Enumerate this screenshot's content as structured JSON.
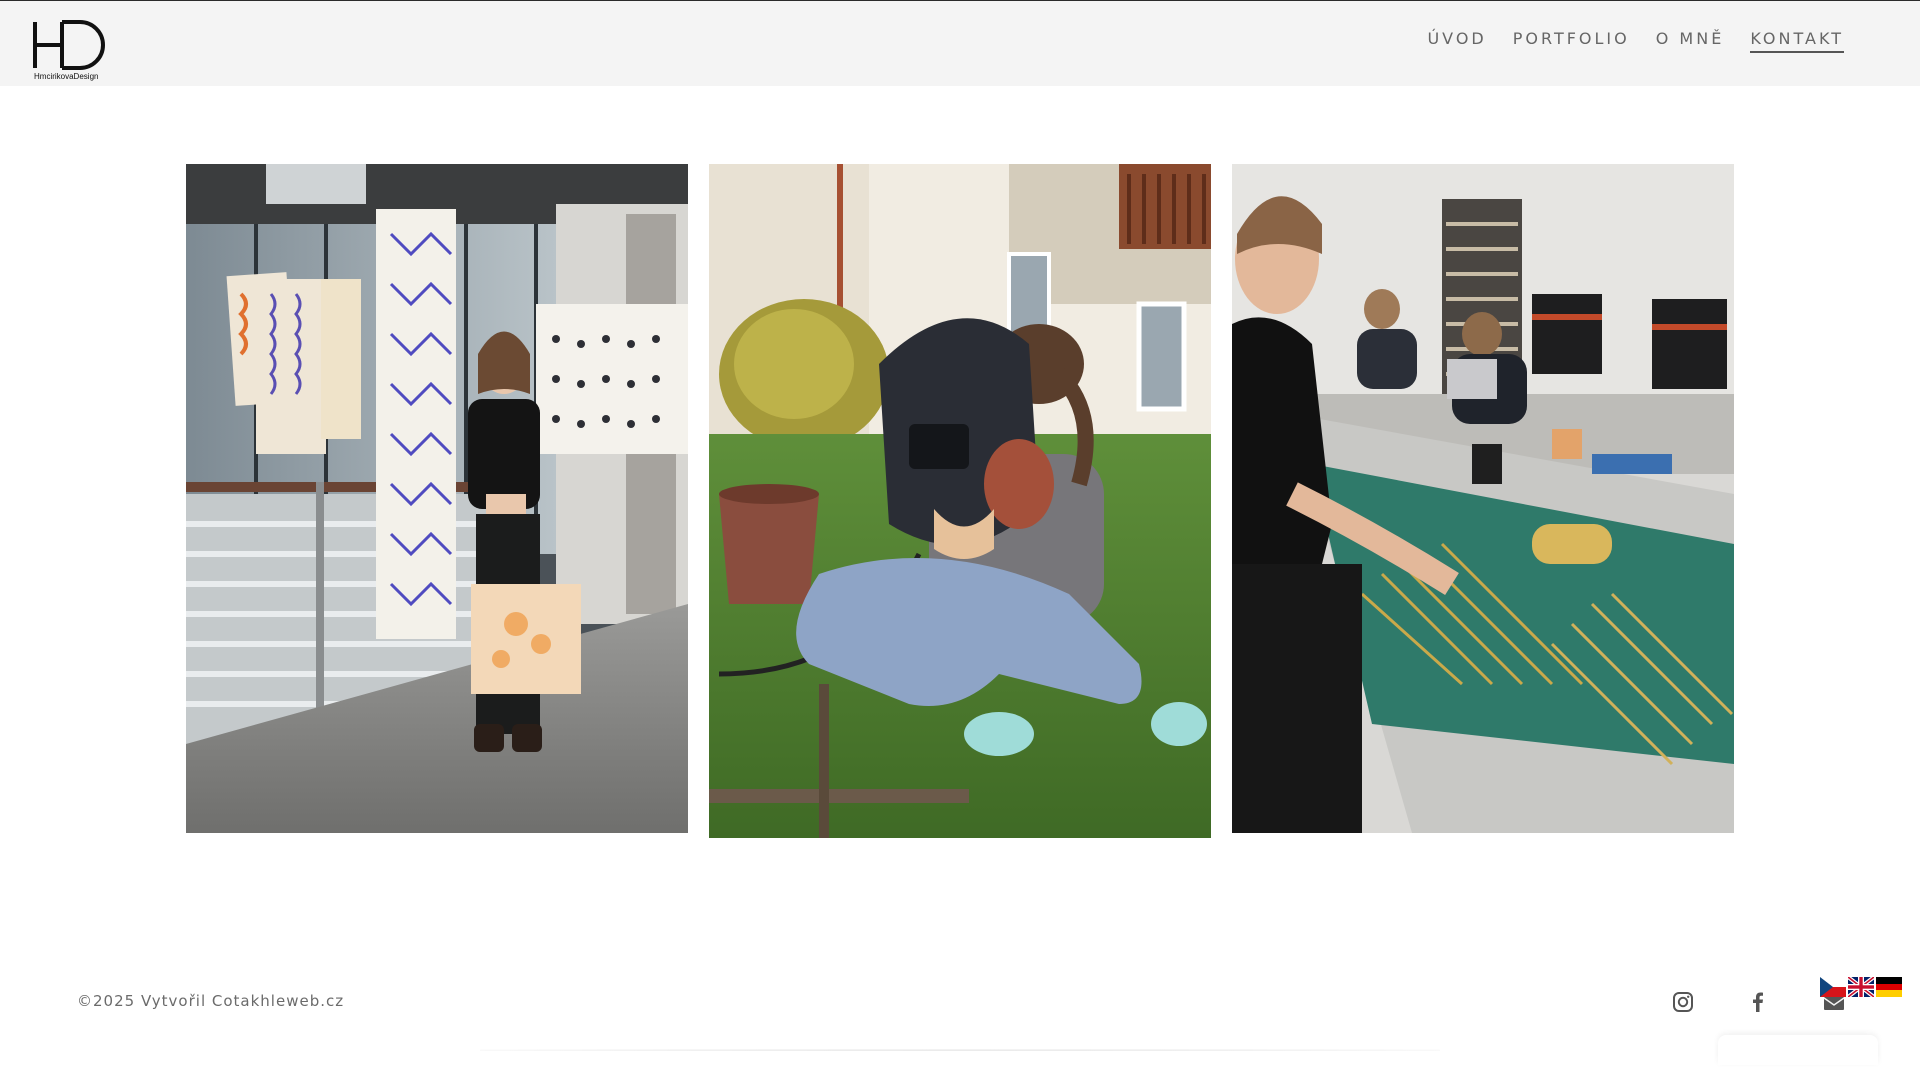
{
  "header": {
    "logo_text": "HD",
    "logo_caption": "HmcirikovaDesign",
    "nav": [
      {
        "label": "ÚVOD",
        "active": false
      },
      {
        "label": "PORTFOLIO",
        "active": false
      },
      {
        "label": "O MNĚ",
        "active": false
      },
      {
        "label": "KONTAKT",
        "active": true
      }
    ]
  },
  "gallery": {
    "photos": [
      {
        "icon": "photo-exhibition"
      },
      {
        "icon": "photo-welding"
      },
      {
        "icon": "photo-workshop"
      }
    ]
  },
  "footer": {
    "copyright": "©2025 Vytvořil Cotakhleweb.cz",
    "social_icons": [
      "instagram-icon",
      "facebook-icon",
      "mail-icon"
    ],
    "languages": [
      "cs-flag-icon",
      "en-flag-icon",
      "de-flag-icon"
    ]
  },
  "colors": {
    "header_bg": "#f4f4f4",
    "nav_text": "#666666",
    "footer_text": "#6b6b6b"
  }
}
